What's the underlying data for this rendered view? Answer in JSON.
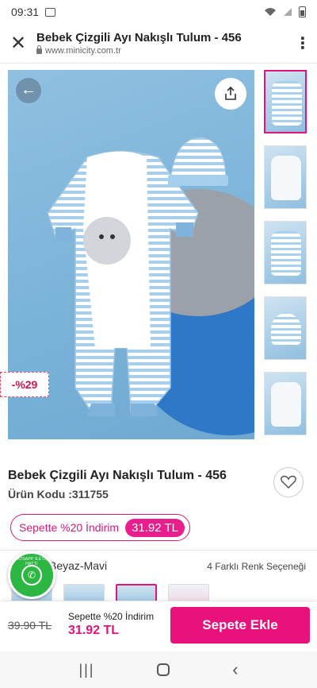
{
  "status": {
    "time": "09:31"
  },
  "appbar": {
    "title": "Bebek Çizgili Ayı Nakışlı Tulum - 456",
    "url": "www.minicity.com.tr"
  },
  "hero": {
    "discount_badge": "-%29",
    "dots_total": 5,
    "dots_active": 1
  },
  "product": {
    "title": "Bebek Çizgili Ayı Nakışlı Tulum - 456",
    "code": "Ürün Kodu :311755",
    "promo_text": "Sepette %20 İndirim",
    "promo_price": "31.92 TL"
  },
  "colors": {
    "selected": "Beyaz-Mavi",
    "count_label": "4 Farklı Renk Seçeneği"
  },
  "whatsapp": {
    "label": "WHATSAPP İLETİŞİM HATTI"
  },
  "bottom": {
    "old_price": "39.90 TL",
    "promo_text": "Sepette %20 İndirim",
    "price": "31.92 TL",
    "add_to_cart": "Sepete Ekle"
  },
  "accent": "#e9117a"
}
